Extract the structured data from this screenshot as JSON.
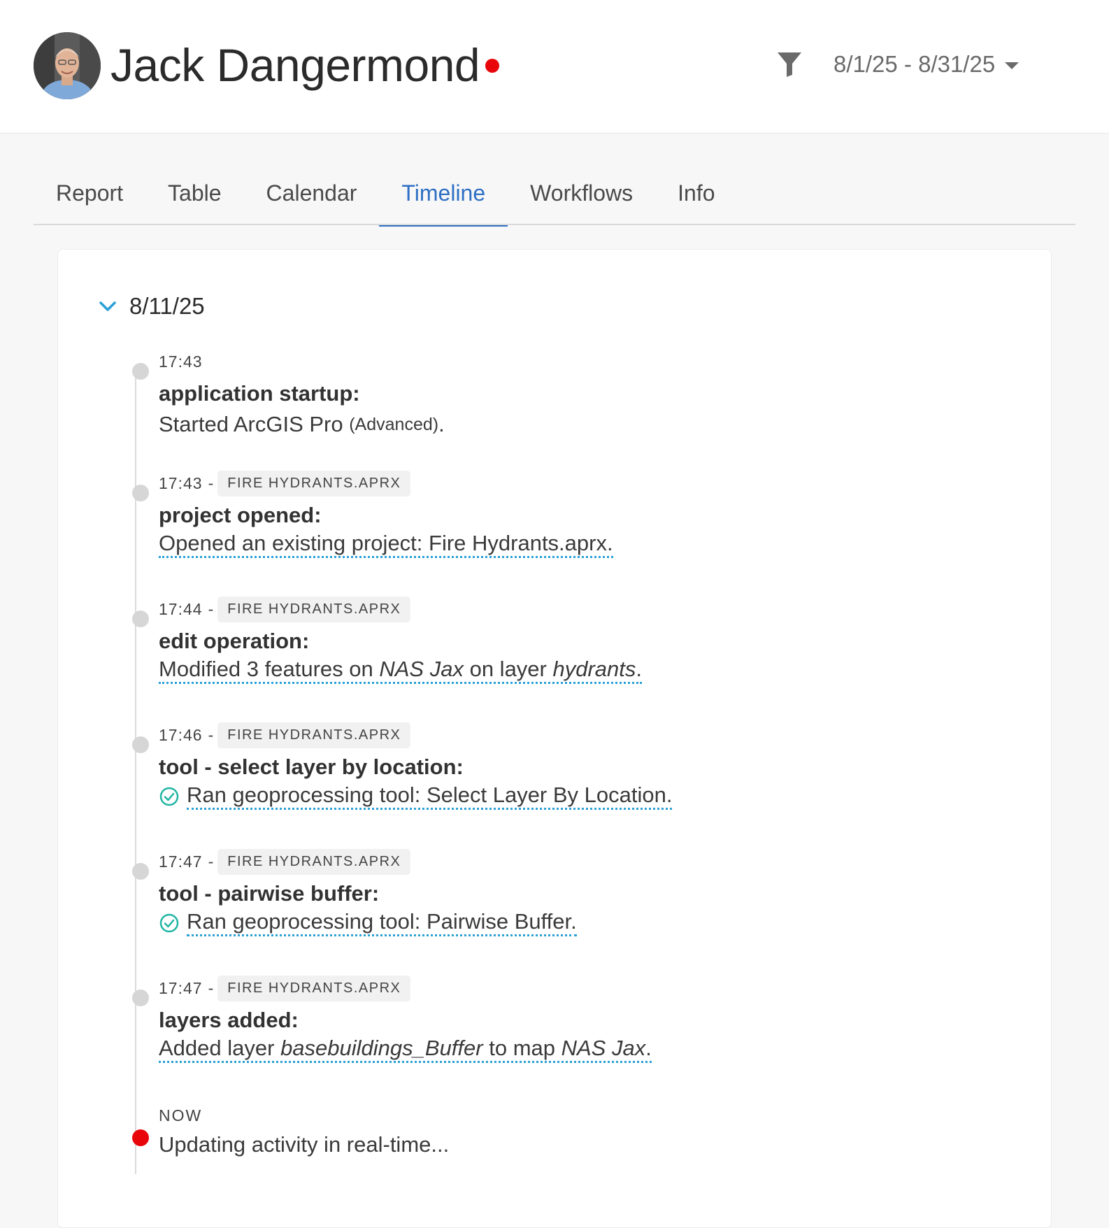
{
  "header": {
    "user_name": "Jack Dangermond",
    "live_status_color": "#e8060a",
    "filter_icon": "filter-icon",
    "date_range": "8/1/25 - 8/31/25"
  },
  "tabs": [
    {
      "label": "Report",
      "active": false
    },
    {
      "label": "Table",
      "active": false
    },
    {
      "label": "Calendar",
      "active": false
    },
    {
      "label": "Timeline",
      "active": true
    },
    {
      "label": "Workflows",
      "active": false
    },
    {
      "label": "Info",
      "active": false
    }
  ],
  "timeline": {
    "day": "8/11/25",
    "events": [
      {
        "time": "17:43",
        "title": "application startup:",
        "desc_main": "Started ArcGIS Pro",
        "desc_small": "(Advanced)",
        "desc_end": "."
      },
      {
        "time": "17:43",
        "sep": "-",
        "project": "FIRE HYDRANTS.APRX",
        "title": "project opened:",
        "desc": "Opened an existing project: Fire Hydrants.aprx."
      },
      {
        "time": "17:44",
        "sep": "-",
        "project": "FIRE HYDRANTS.APRX",
        "title": "edit operation:",
        "desc_a": "Modified 3 features on ",
        "desc_b": "NAS Jax",
        "desc_c": " on layer ",
        "desc_d": "hydrants",
        "desc_e": "."
      },
      {
        "time": "17:46",
        "sep": "-",
        "project": "FIRE HYDRANTS.APRX",
        "title": "tool - select layer by location:",
        "desc": "Ran geoprocessing tool: Select Layer By Location."
      },
      {
        "time": "17:47",
        "sep": "-",
        "project": "FIRE HYDRANTS.APRX",
        "title": "tool - pairwise buffer:",
        "desc": "Ran geoprocessing tool: Pairwise Buffer."
      },
      {
        "time": "17:47",
        "sep": "-",
        "project": "FIRE HYDRANTS.APRX",
        "title": "layers added:",
        "desc_a": "Added layer ",
        "desc_b": "basebuildings_Buffer",
        "desc_c": " to map ",
        "desc_d": "NAS Jax",
        "desc_e": "."
      }
    ],
    "now": {
      "label": "NOW",
      "desc": "Updating activity in real-time..."
    }
  },
  "colors": {
    "accent": "#2e6fc4",
    "link_underline": "#2aa0d6",
    "success": "#1fb5a3",
    "live": "#e8060a"
  }
}
